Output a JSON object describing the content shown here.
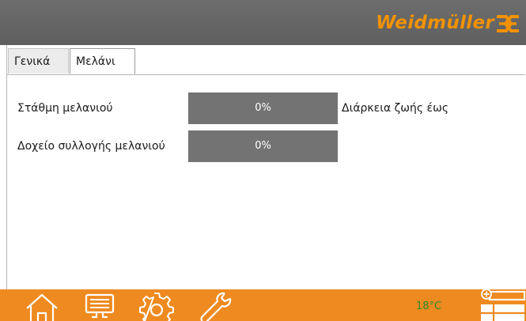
{
  "header": {
    "brand": "Weidmüller"
  },
  "tabs": [
    {
      "label": "Γενικά",
      "active": false
    },
    {
      "label": "Μελάνι",
      "active": true
    }
  ],
  "ink": {
    "level_label": "Στάθμη μελανιού",
    "level_value": "0%",
    "waste_label": "Δοχείο συλλογής μελανιού",
    "waste_value": "0%",
    "lifetime_label": "Διάρκεια ζωής έως"
  },
  "footer": {
    "icons": [
      "home-icon",
      "monitor-icon",
      "settings-icon",
      "wrench-icon",
      "add-job-icon"
    ],
    "temperature": "18°C",
    "accent": "#ee8a1f"
  }
}
